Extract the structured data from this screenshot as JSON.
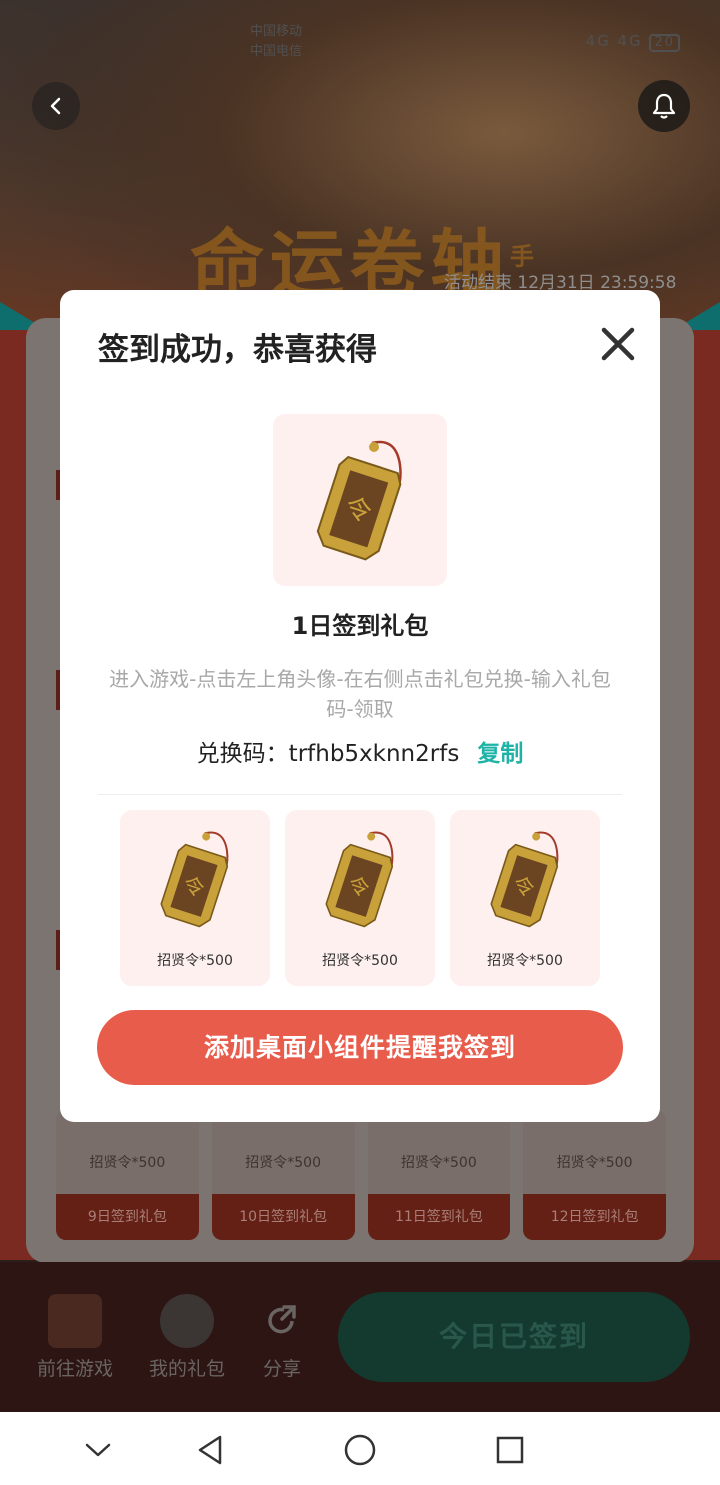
{
  "status_bar": {
    "carrier_line1": "中国移动",
    "carrier_line2": "中国电信",
    "signal": "4G 4G",
    "battery": "20"
  },
  "background": {
    "game_title": "命运卷轴",
    "game_title_suffix": "手",
    "activity_end": "活动结束 12月31日 23:59:58",
    "gift_cells": [
      {
        "name": "招贤令*500",
        "day": "9日签到礼包"
      },
      {
        "name": "招贤令*500",
        "day": "10日签到礼包"
      },
      {
        "name": "招贤令*500",
        "day": "11日签到礼包"
      },
      {
        "name": "招贤令*500",
        "day": "12日签到礼包"
      }
    ],
    "bottom_bar": {
      "go_game": "前往游戏",
      "my_gifts": "我的礼包",
      "share": "分享",
      "checked_in": "今日已签到"
    }
  },
  "dialog": {
    "title": "签到成功，恭喜获得",
    "pack_name": "1日签到礼包",
    "instructions": "进入游戏-点击左上角头像-在右侧点击礼包兑换-输入礼包码-领取",
    "code_label": "兑换码：",
    "code_value": "trfhb5xknn2rfs",
    "copy_label": "复制",
    "items": [
      {
        "label": "招贤令*500"
      },
      {
        "label": "招贤令*500"
      },
      {
        "label": "招贤令*500"
      }
    ],
    "widget_button": "添加桌面小组件提醒我签到"
  },
  "colors": {
    "accent": "#e85c4c",
    "copy": "#1fb3a7",
    "token_gold": "#c9a13a"
  },
  "icons": [
    "back-icon",
    "bell-icon",
    "close-icon",
    "token-icon",
    "share-icon",
    "nav-back-icon",
    "nav-home-icon",
    "nav-recent-icon",
    "nav-collapse-icon"
  ]
}
